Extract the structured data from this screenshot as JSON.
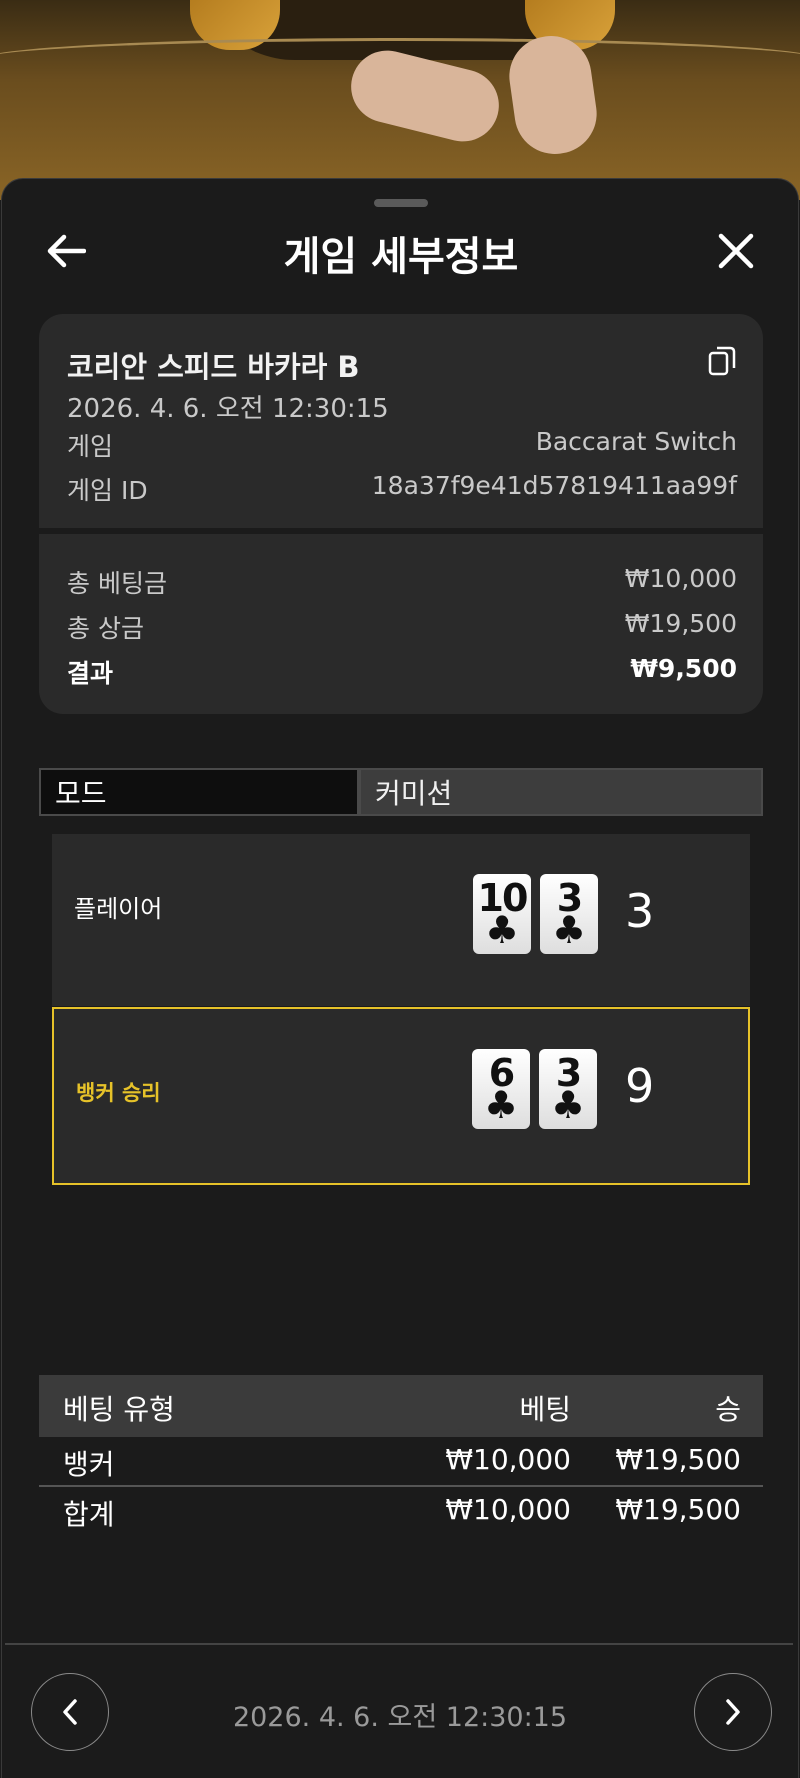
{
  "header": {
    "title": "게임 세부정보",
    "back_icon": "arrow-left-icon",
    "close_icon": "close-icon"
  },
  "game_info": {
    "table_name": "코리안 스피드 바카라 B",
    "datetime": "2026. 4. 6. 오전 12:30:15",
    "game_label": "게임",
    "game_value": "Baccarat Switch",
    "game_id_label": "게임 ID",
    "game_id_value": "18a37f9e41d57819411aa99f",
    "copy_icon": "copy-icon"
  },
  "summary": {
    "total_bet_label": "총 베팅금",
    "total_bet_value": "₩10,000",
    "total_win_label": "총 상금",
    "total_win_value": "₩19,500",
    "result_label": "결과",
    "result_value": "₩9,500"
  },
  "tabs": [
    {
      "label": "모드",
      "active": true
    },
    {
      "label": "커미션",
      "active": false
    }
  ],
  "hands": {
    "player": {
      "label": "플레이어",
      "cards": [
        {
          "rank": "10",
          "suit": "♣"
        },
        {
          "rank": "3",
          "suit": "♣"
        }
      ],
      "score": "3"
    },
    "banker": {
      "label": "뱅커 승리",
      "cards": [
        {
          "rank": "6",
          "suit": "♣"
        },
        {
          "rank": "3",
          "suit": "♣"
        }
      ],
      "score": "9"
    }
  },
  "bets_table": {
    "headers": [
      "베팅 유형",
      "베팅",
      "승"
    ],
    "rows": [
      {
        "type": "뱅커",
        "bet": "₩10,000",
        "win": "₩19,500"
      }
    ],
    "total": {
      "type": "합계",
      "bet": "₩10,000",
      "win": "₩19,500"
    }
  },
  "footer": {
    "datetime": "2026. 4. 6. 오전 12:30:15",
    "prev_icon": "chevron-left-icon",
    "next_icon": "chevron-right-icon"
  },
  "colors": {
    "background": "#1b1b1b",
    "card_bg": "#2a2a2a",
    "winner_accent": "#e6c229"
  }
}
